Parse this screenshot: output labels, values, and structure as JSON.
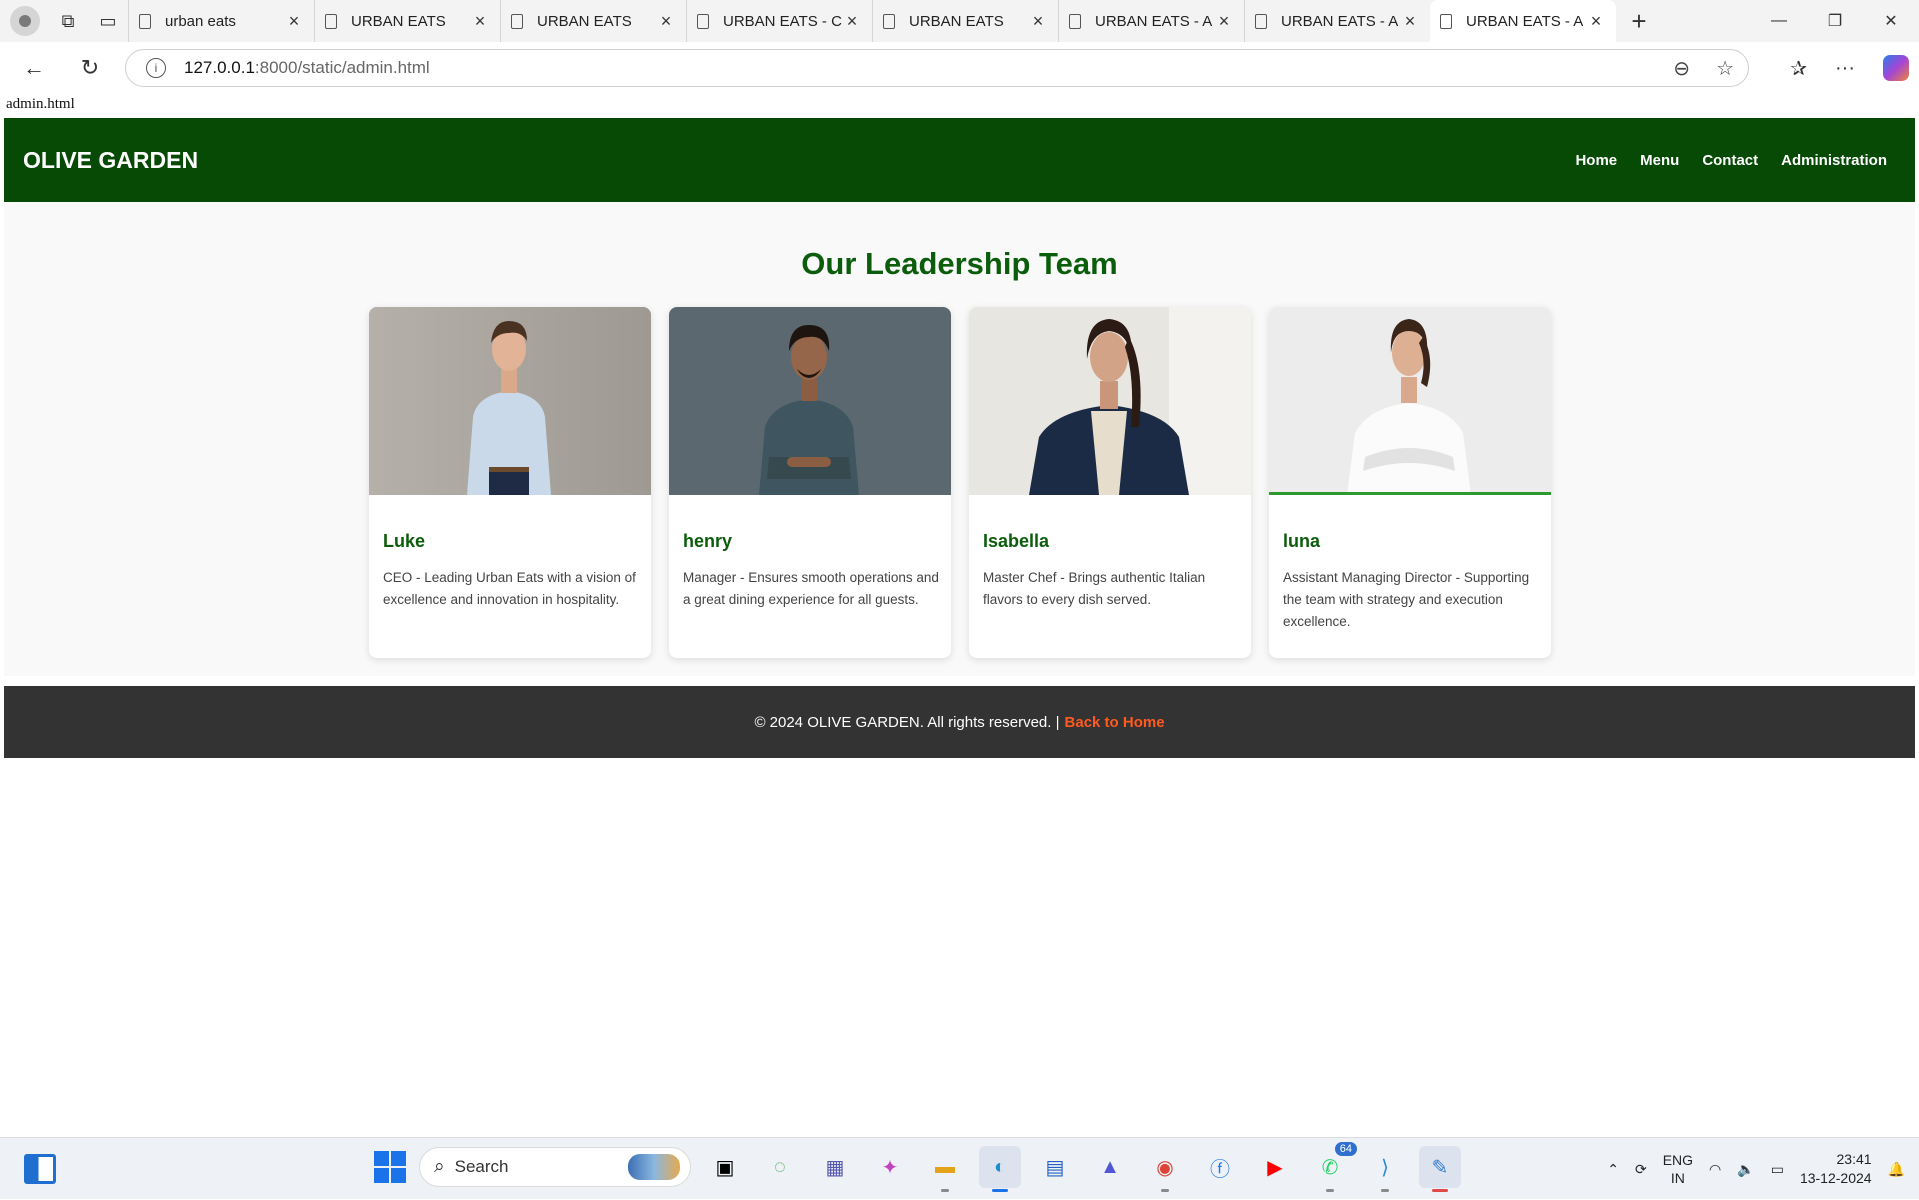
{
  "browser": {
    "tabs": [
      {
        "title": "urban eats"
      },
      {
        "title": "URBAN EATS"
      },
      {
        "title": "URBAN EATS"
      },
      {
        "title": "URBAN EATS - C"
      },
      {
        "title": "URBAN EATS"
      },
      {
        "title": "URBAN EATS - A"
      },
      {
        "title": "URBAN EATS - A"
      },
      {
        "title": "URBAN EATS - A"
      }
    ],
    "url_host": "127.0.0.1",
    "url_path": ":8000/static/admin.html"
  },
  "page": {
    "file_label": "admin.html",
    "brand": "OLIVE GARDEN",
    "nav": [
      {
        "label": "Home"
      },
      {
        "label": "Menu"
      },
      {
        "label": "Contact"
      },
      {
        "label": "Administration"
      }
    ],
    "section_title": "Our Leadership Team",
    "team": [
      {
        "name": "Luke",
        "description": "CEO - Leading Urban Eats with a vision of excellence and innovation in hospitality."
      },
      {
        "name": "henry",
        "description": "Manager - Ensures smooth operations and a great dining experience for all guests."
      },
      {
        "name": "Isabella",
        "description": "Master Chef - Brings authentic Italian flavors to every dish served."
      },
      {
        "name": "luna",
        "description": "Assistant Managing Director - Supporting the team with strategy and execution excellence."
      }
    ],
    "footer_text": "© 2024 OLIVE GARDEN. All rights reserved. |",
    "footer_link": "Back to Home"
  },
  "taskbar": {
    "search_placeholder": "Search",
    "whatsapp_badge": "64",
    "lang_primary": "ENG",
    "lang_region": "IN",
    "time": "23:41",
    "date": "13-12-2024"
  },
  "colors": {
    "header_green": "#064a06",
    "title_green": "#0b5d0b",
    "footer_bg": "#333333",
    "footer_link": "#ff5a1f"
  }
}
